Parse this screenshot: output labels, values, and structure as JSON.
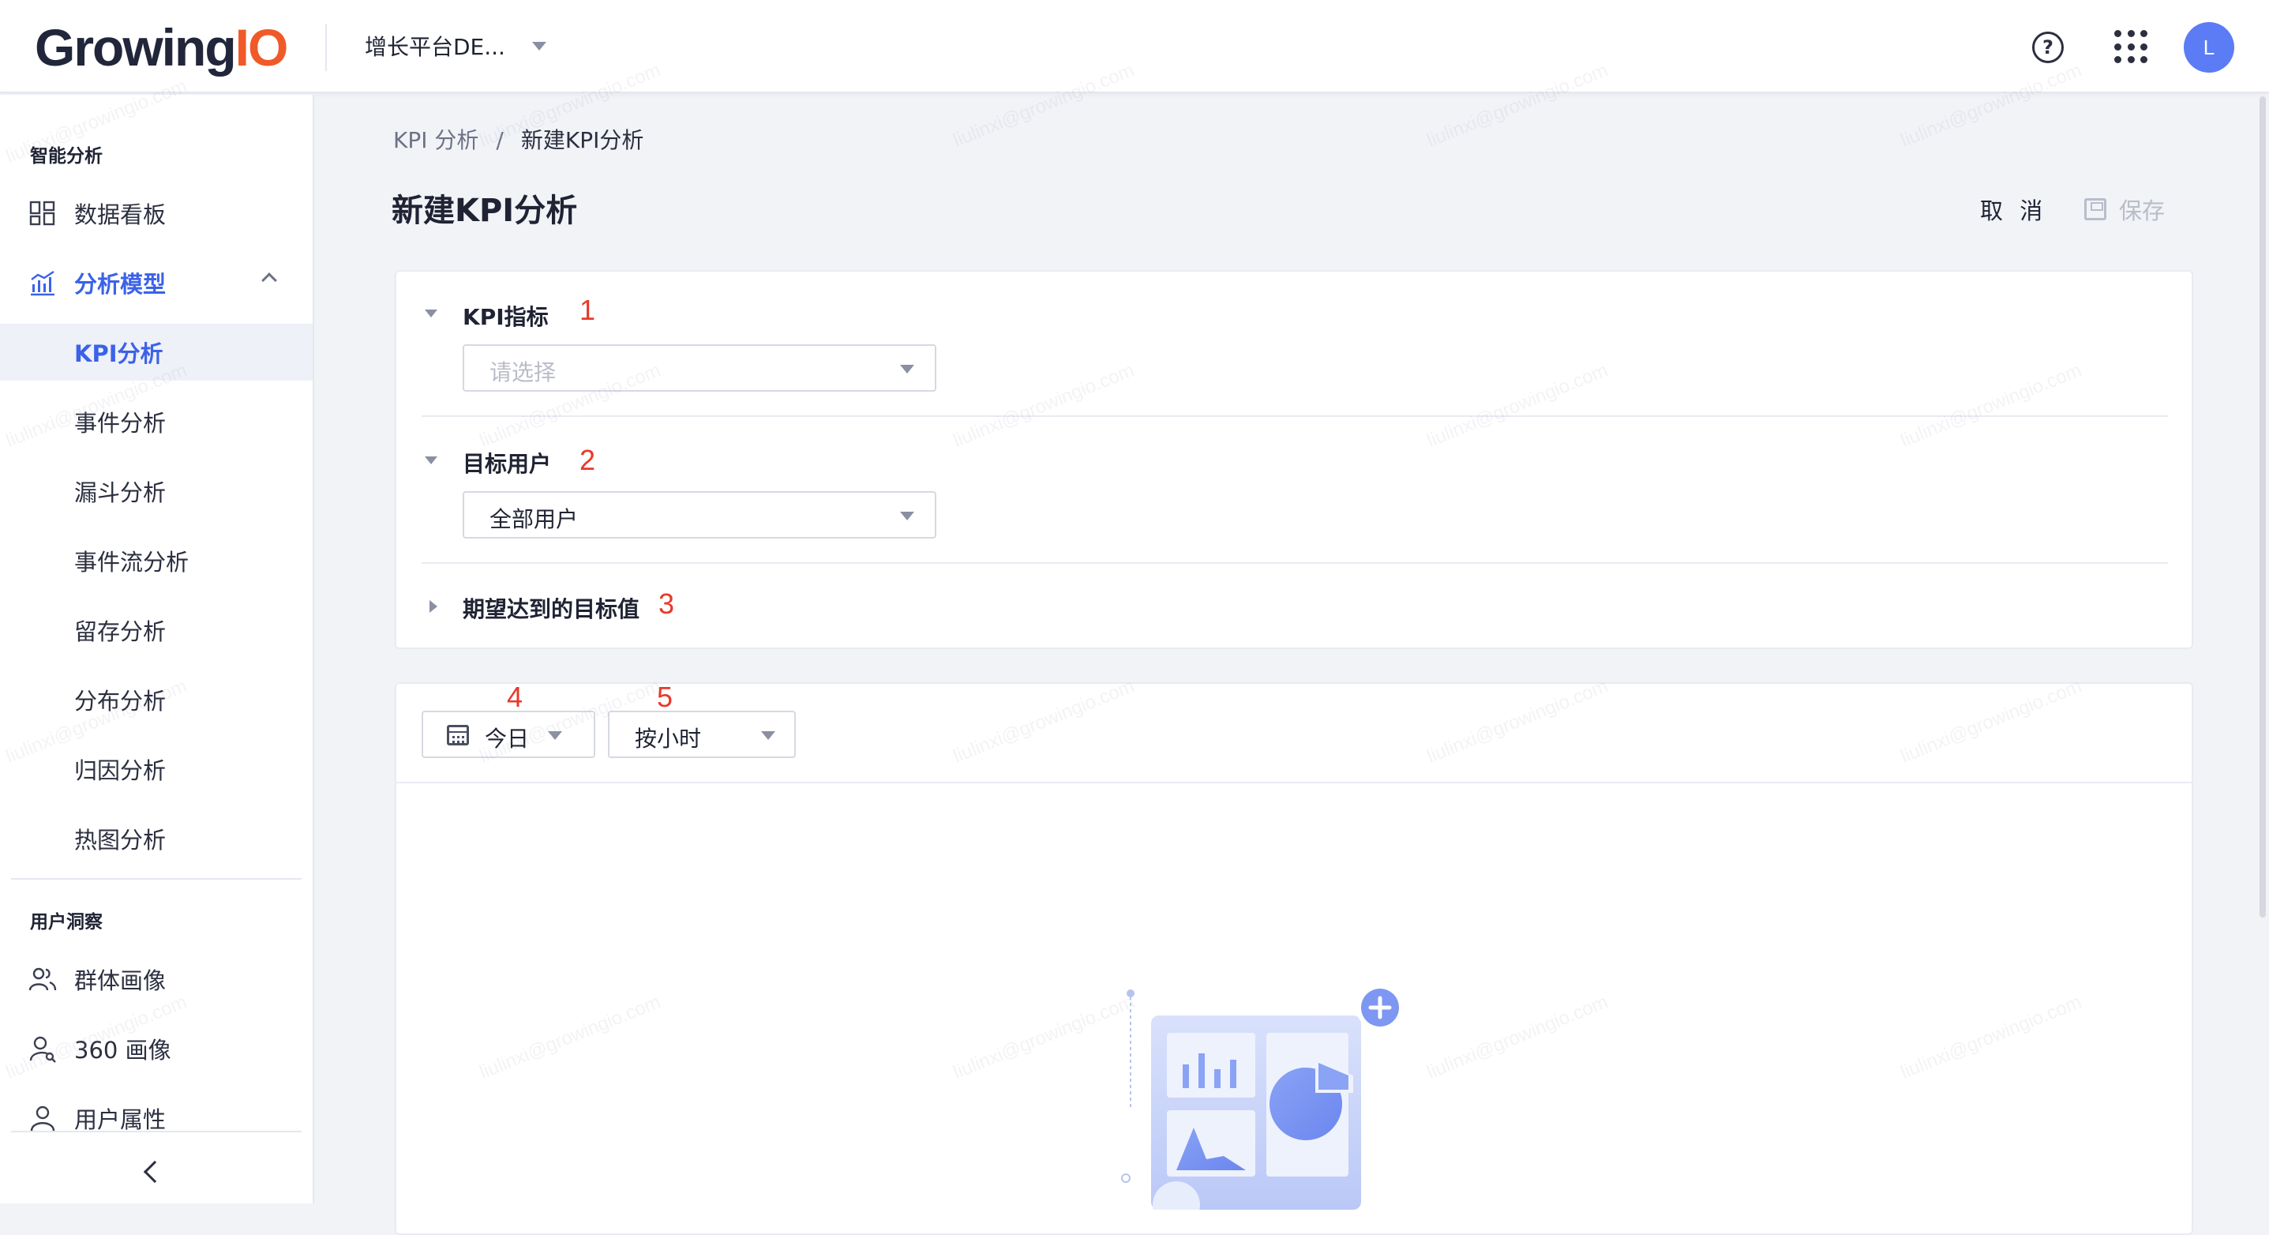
{
  "header": {
    "logo_text_main": "Growing",
    "logo_text_accent": "IO",
    "project_name": "增长平台DE...",
    "avatar_initial": "L"
  },
  "sidebar": {
    "group1_title": "智能分析",
    "group2_title": "用户洞察",
    "items": [
      {
        "label": "数据看板",
        "icon": "dashboard-icon"
      },
      {
        "label": "分析模型",
        "icon": "chart-icon"
      },
      {
        "label": "KPI分析"
      },
      {
        "label": "事件分析"
      },
      {
        "label": "漏斗分析"
      },
      {
        "label": "事件流分析"
      },
      {
        "label": "留存分析"
      },
      {
        "label": "分布分析"
      },
      {
        "label": "归因分析"
      },
      {
        "label": "热图分析"
      }
    ],
    "insight_items": [
      {
        "label": "群体画像",
        "icon": "group-icon"
      },
      {
        "label": "360 画像",
        "icon": "user-search-icon"
      },
      {
        "label": "用户属性",
        "icon": "user-icon"
      }
    ]
  },
  "breadcrumb": {
    "parent": "KPI 分析",
    "separator": "/",
    "current": "新建KPI分析"
  },
  "page": {
    "title": "新建KPI分析",
    "cancel_label": "取 消",
    "save_label": "保存"
  },
  "config": {
    "kpi": {
      "title": "KPI指标",
      "number": "1",
      "placeholder": "请选择"
    },
    "target": {
      "title": "目标用户",
      "number": "2",
      "value": "全部用户"
    },
    "goal": {
      "title": "期望达到的目标值",
      "number": "3"
    }
  },
  "toolbar": {
    "date_label": "今日",
    "date_number": "4",
    "granularity_label": "按小时",
    "granularity_number": "5"
  },
  "watermark": "liulinxi@growingio.com",
  "colors": {
    "accent": "#3b62e8",
    "brand_orange": "#f05a28",
    "annotation_red": "#e8392a"
  }
}
